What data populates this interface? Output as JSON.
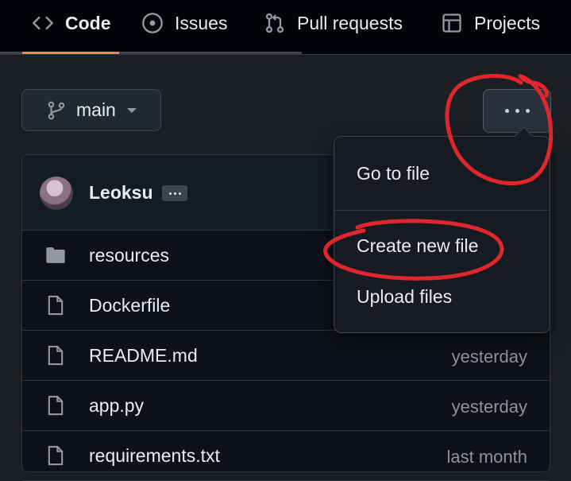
{
  "nav": {
    "tabs": [
      {
        "label": "Code",
        "icon": "code-icon",
        "active": true
      },
      {
        "label": "Issues",
        "icon": "issue-opened-icon",
        "active": false
      },
      {
        "label": "Pull requests",
        "icon": "git-pull-request-icon",
        "active": false
      },
      {
        "label": "Projects",
        "icon": "table-icon",
        "active": false
      }
    ]
  },
  "branch": {
    "name": "main",
    "icon": "git-branch-icon"
  },
  "more_button": {
    "icon": "kebab-horizontal-icon"
  },
  "commit": {
    "author": "Leoksu"
  },
  "files": [
    {
      "name": "resources",
      "type": "folder",
      "date": ""
    },
    {
      "name": "Dockerfile",
      "type": "file",
      "date": ""
    },
    {
      "name": "README.md",
      "type": "file",
      "date": "yesterday"
    },
    {
      "name": "app.py",
      "type": "file",
      "date": "yesterday"
    },
    {
      "name": "requirements.txt",
      "type": "file",
      "date": "last month"
    }
  ],
  "menu": {
    "go_to_file": "Go to file",
    "create_new_file": "Create new file",
    "upload_files": "Upload files"
  },
  "colors": {
    "accent_underline": "#f78166",
    "annotation_red": "#e0262d",
    "background": "#1b1f24"
  }
}
